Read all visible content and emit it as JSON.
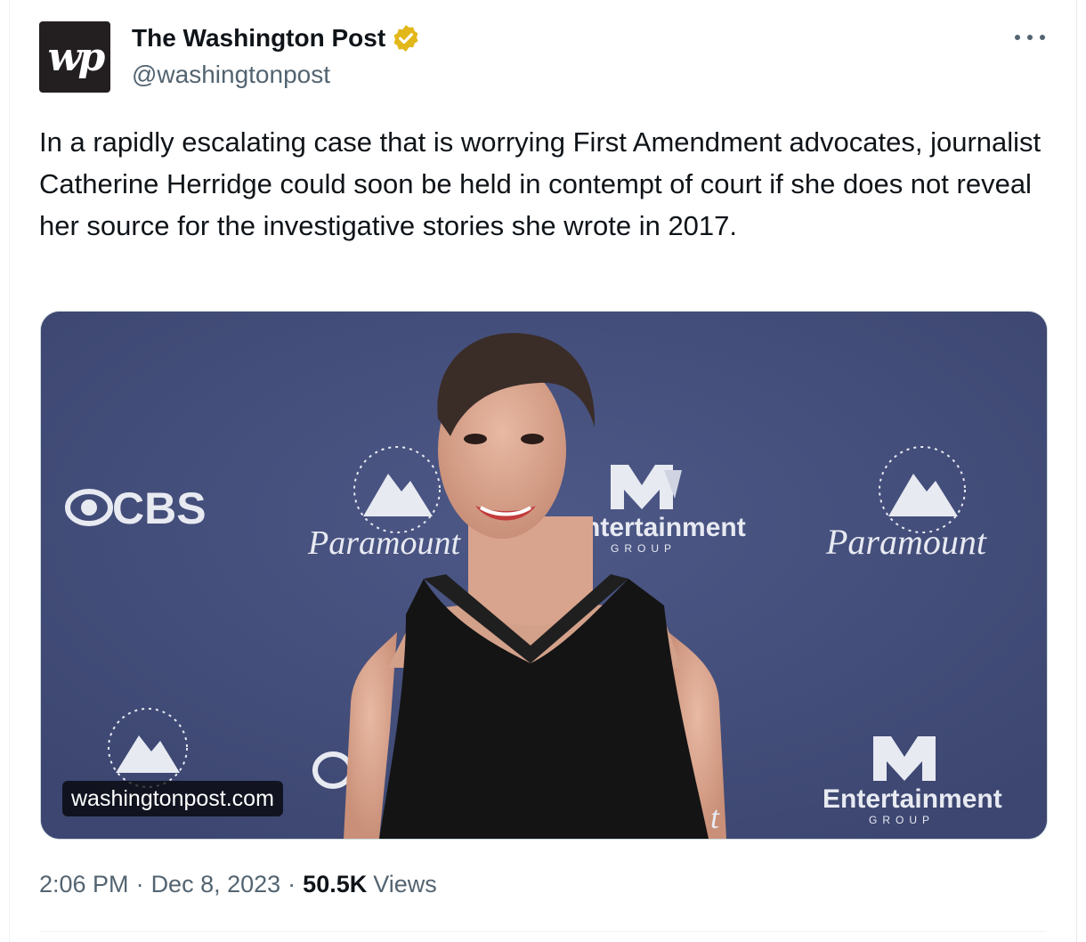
{
  "account": {
    "avatar_text": "wp",
    "display_name": "The Washington Post",
    "handle": "@washingtonpost",
    "verified_badge_color": "#e2b719"
  },
  "tweet": {
    "text": "In a rapidly escalating case that is worrying First Amendment advocates, journalist Catherine Herridge could soon be held in contempt of court if she does not reveal her source for the investigative stories she wrote in 2017.",
    "link_domain": "washingtonpost.com",
    "time": "2:06 PM",
    "date": "Dec 8, 2023",
    "views_count": "50.5K",
    "views_label": "Views",
    "separator": "·"
  },
  "media": {
    "backdrop_color": "#45507a",
    "backdrop_logos": [
      "CBS",
      "Paramount",
      "Entertainment",
      "GROUP",
      "Paramount",
      "Paramount",
      "Entertainment",
      "GROUP"
    ]
  },
  "icons": {
    "more": "more-dots-icon",
    "verified": "verified-badge-icon"
  }
}
